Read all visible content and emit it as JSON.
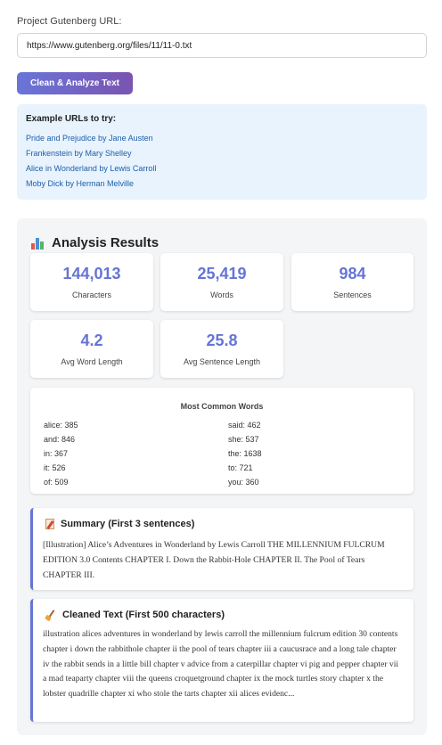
{
  "form": {
    "url_label": "Project Gutenberg URL:",
    "url_value": "https://www.gutenberg.org/files/11/11-0.txt",
    "analyze_button": "Clean & Analyze Text"
  },
  "examples": {
    "title": "Example URLs to try:",
    "links": [
      "Pride and Prejudice by Jane Austen",
      "Frankenstein by Mary Shelley",
      "Alice in Wonderland by Lewis Carroll",
      "Moby Dick by Herman Melville"
    ]
  },
  "results": {
    "title": "Analysis Results",
    "title_icon": "bar-chart-icon",
    "stats": [
      {
        "value": "144,013",
        "label": "Characters"
      },
      {
        "value": "25,419",
        "label": "Words"
      },
      {
        "value": "984",
        "label": "Sentences"
      },
      {
        "value": "4.2",
        "label": "Avg Word Length"
      },
      {
        "value": "25.8",
        "label": "Avg Sentence Length"
      }
    ],
    "common_words": {
      "title": "Most Common Words",
      "left": [
        "alice: 385",
        "and: 846",
        "in: 367",
        "it: 526",
        "of: 509"
      ],
      "right": [
        "said: 462",
        "she: 537",
        "the: 1638",
        "to: 721",
        "you: 360"
      ]
    },
    "summary": {
      "title": "Summary (First 3 sentences)",
      "icon": "memo-icon",
      "text": "[Illustration] Alice’s Adventures in Wonderland by Lewis Carroll THE MILLENNIUM FULCRUM EDITION 3.0 Contents CHAPTER I. Down the Rabbit-Hole CHAPTER II. The Pool of Tears CHAPTER III."
    },
    "cleaned": {
      "title": "Cleaned Text (First 500 characters)",
      "icon": "broom-icon",
      "text": "illustration alices adventures in wonderland by lewis carroll the millennium fulcrum edition 30 contents chapter i down the rabbithole chapter ii the pool of tears chapter iii a caucusrace and a long tale chapter iv the rabbit sends in a little bill chapter v advice from a caterpillar chapter vi pig and pepper chapter vii a mad teaparty chapter viii the queens croquetground chapter ix the mock turtles story chapter x the lobster quadrille chapter xi who stole the tarts chapter xii alices evidenc..."
    }
  },
  "colors": {
    "accent": "#6574d6",
    "button_gradient_start": "#6a75d8",
    "button_gradient_end": "#7a54b0",
    "examples_bg": "#e8f3fd",
    "link": "#1d5fa8"
  }
}
